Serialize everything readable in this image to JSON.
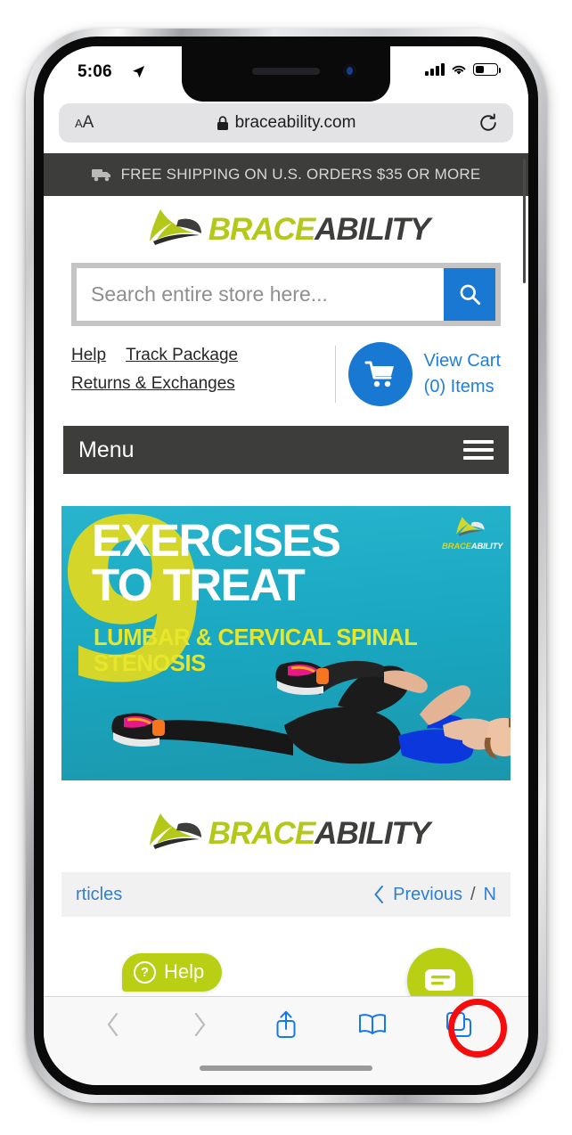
{
  "status_bar": {
    "time": "5:06",
    "location_icon": "location-arrow-icon",
    "signal_icon": "cellular-signal-icon",
    "wifi_icon": "wifi-icon",
    "battery_icon": "battery-icon",
    "battery_level_percent": 42
  },
  "browser": {
    "name": "Safari",
    "text_size_label_small": "A",
    "text_size_label_large": "A",
    "lock_icon": "lock-icon",
    "url": "braceability.com",
    "reload_icon": "reload-icon",
    "toolbar": {
      "back_icon": "chevron-left-icon",
      "forward_icon": "chevron-right-icon",
      "share_icon": "share-icon",
      "bookmarks_icon": "book-icon",
      "tabs_icon": "tabs-icon"
    },
    "annotation": {
      "type": "circle-highlight",
      "target": "tabs-button",
      "color": "#f50d0d"
    }
  },
  "page": {
    "shipping_banner": {
      "truck_icon": "truck-icon",
      "text": "FREE SHIPPING ON U.S. ORDERS $35 OR MORE"
    },
    "logo": {
      "mark_icon": "braceability-swoosh-icon",
      "brace": "BRACE",
      "ability": "ABILITY"
    },
    "search": {
      "placeholder": "Search entire store here...",
      "value": "",
      "button_icon": "search-icon"
    },
    "util_links": [
      "Help",
      "Track Package",
      "Returns & Exchanges"
    ],
    "cart": {
      "icon": "shopping-cart-icon",
      "view_label": "View Cart",
      "items_label": "(0) Items"
    },
    "menu": {
      "label": "Menu",
      "icon": "hamburger-icon"
    },
    "hero": {
      "number": "9",
      "title_line1": "EXERCISES",
      "title_line2": "TO TREAT",
      "subtitle": "LUMBAR & CERVICAL SPINAL STENOSIS",
      "logo_brace": "BRACE",
      "logo_ability": "ABILITY",
      "figure_alt": "woman-knee-to-chest-stretch"
    },
    "article_nav": {
      "back_label": "rticles",
      "prev_icon": "chevron-left-icon",
      "prev_label": "Previous",
      "separator": "/",
      "next_label": "N"
    },
    "help_widget": {
      "icon": "question-mark-icon",
      "label": "Help"
    },
    "chat_widget": {
      "icon": "chat-bubble-icon"
    }
  },
  "colors": {
    "brand_green": "#b3c818",
    "brand_dark": "#3d3d3b",
    "link_blue": "#1878d2",
    "hero_teal": "#1aa8c2",
    "hero_yellow": "#d4d62a",
    "annotation_red": "#f50d0d"
  }
}
